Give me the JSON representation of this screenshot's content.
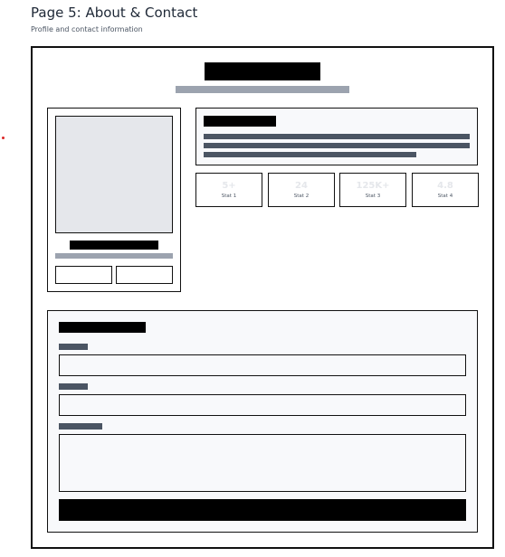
{
  "page": {
    "title": "Page 5: About & Contact",
    "subtitle": "Profile and contact information"
  },
  "colors": {
    "placeholder_dark": "#000000",
    "placeholder_gray": "#9ca3af",
    "placeholder_slate": "#4b5563",
    "photo_fill": "#e5e7eb",
    "panel_fill": "#f8f9fb",
    "marker_red": "#dc2626"
  },
  "stats": [
    {
      "value": "5+",
      "label": "Stat 1"
    },
    {
      "value": "24",
      "label": "Stat 2"
    },
    {
      "value": "125K+",
      "label": "Stat 3"
    },
    {
      "value": "4.8",
      "label": "Stat 4"
    }
  ]
}
